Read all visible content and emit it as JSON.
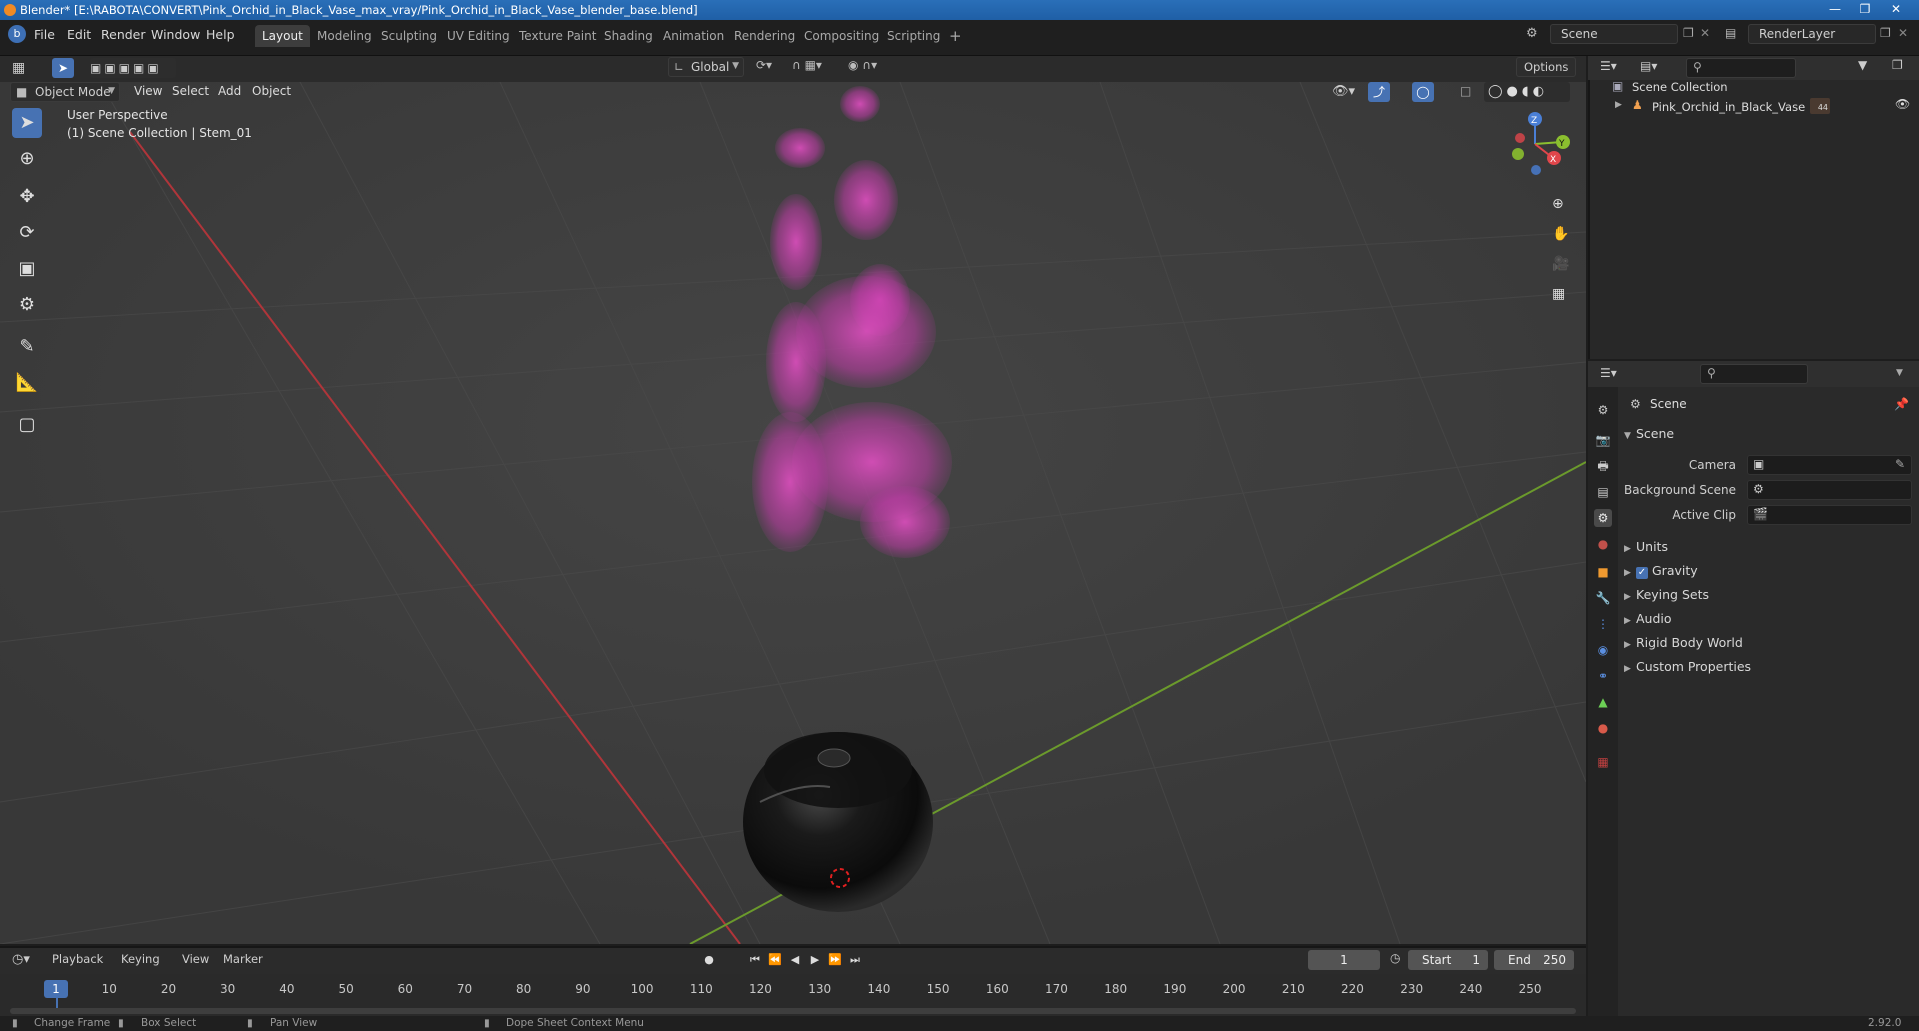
{
  "window": {
    "title": "Blender* [E:\\RABOTA\\CONVERT\\Pink_Orchid_in_Black_Vase_max_vray/Pink_Orchid_in_Black_Vase_blender_base.blend]"
  },
  "menu": [
    "File",
    "Edit",
    "Render",
    "Window",
    "Help"
  ],
  "workspaces": [
    "Layout",
    "Modeling",
    "Sculpting",
    "UV Editing",
    "Texture Paint",
    "Shading",
    "Animation",
    "Rendering",
    "Compositing",
    "Scripting"
  ],
  "scene_selector": {
    "value": "Scene"
  },
  "layer_selector": {
    "value": "RenderLayer"
  },
  "viewport": {
    "mode": "Object Mode",
    "menus": [
      "View",
      "Select",
      "Add",
      "Object"
    ],
    "transform_orientation": "Global",
    "options_label": "Options",
    "perspective_label": "User Perspective",
    "collection_label": "(1) Scene Collection | Stem_01"
  },
  "gizmo": {
    "z": "Z",
    "y": "Y",
    "x": "X"
  },
  "outliner": {
    "root": "Scene Collection",
    "items": [
      {
        "label": "Pink_Orchid_in_Black_Vase",
        "count": "44"
      }
    ]
  },
  "properties": {
    "context": "Scene",
    "section": "Scene",
    "camera_label": "Camera",
    "background_scene_label": "Background Scene",
    "active_clip_label": "Active Clip",
    "panels": [
      "Units",
      "Gravity",
      "Keying Sets",
      "Audio",
      "Rigid Body World",
      "Custom Properties"
    ],
    "gravity_checked": true
  },
  "timeline": {
    "menus": [
      "Playback",
      "Keying",
      "View",
      "Marker"
    ],
    "current_frame": "1",
    "start_label": "Start",
    "start": "1",
    "end_label": "End",
    "end": "250",
    "ticks": [
      "1",
      "10",
      "20",
      "30",
      "40",
      "50",
      "60",
      "70",
      "80",
      "90",
      "100",
      "110",
      "120",
      "130",
      "140",
      "150",
      "160",
      "170",
      "180",
      "190",
      "200",
      "210",
      "220",
      "230",
      "240",
      "250"
    ]
  },
  "statusbar": {
    "items": [
      "Change Frame",
      "Box Select",
      "Pan View",
      "Dope Sheet Context Menu"
    ],
    "version": "2.92.0"
  },
  "colors": {
    "accent": "#4772b3",
    "orchid": "#d23fb8",
    "vase": "#151515",
    "x_axis": "#c0373c",
    "y_axis": "#6f9a2a"
  }
}
